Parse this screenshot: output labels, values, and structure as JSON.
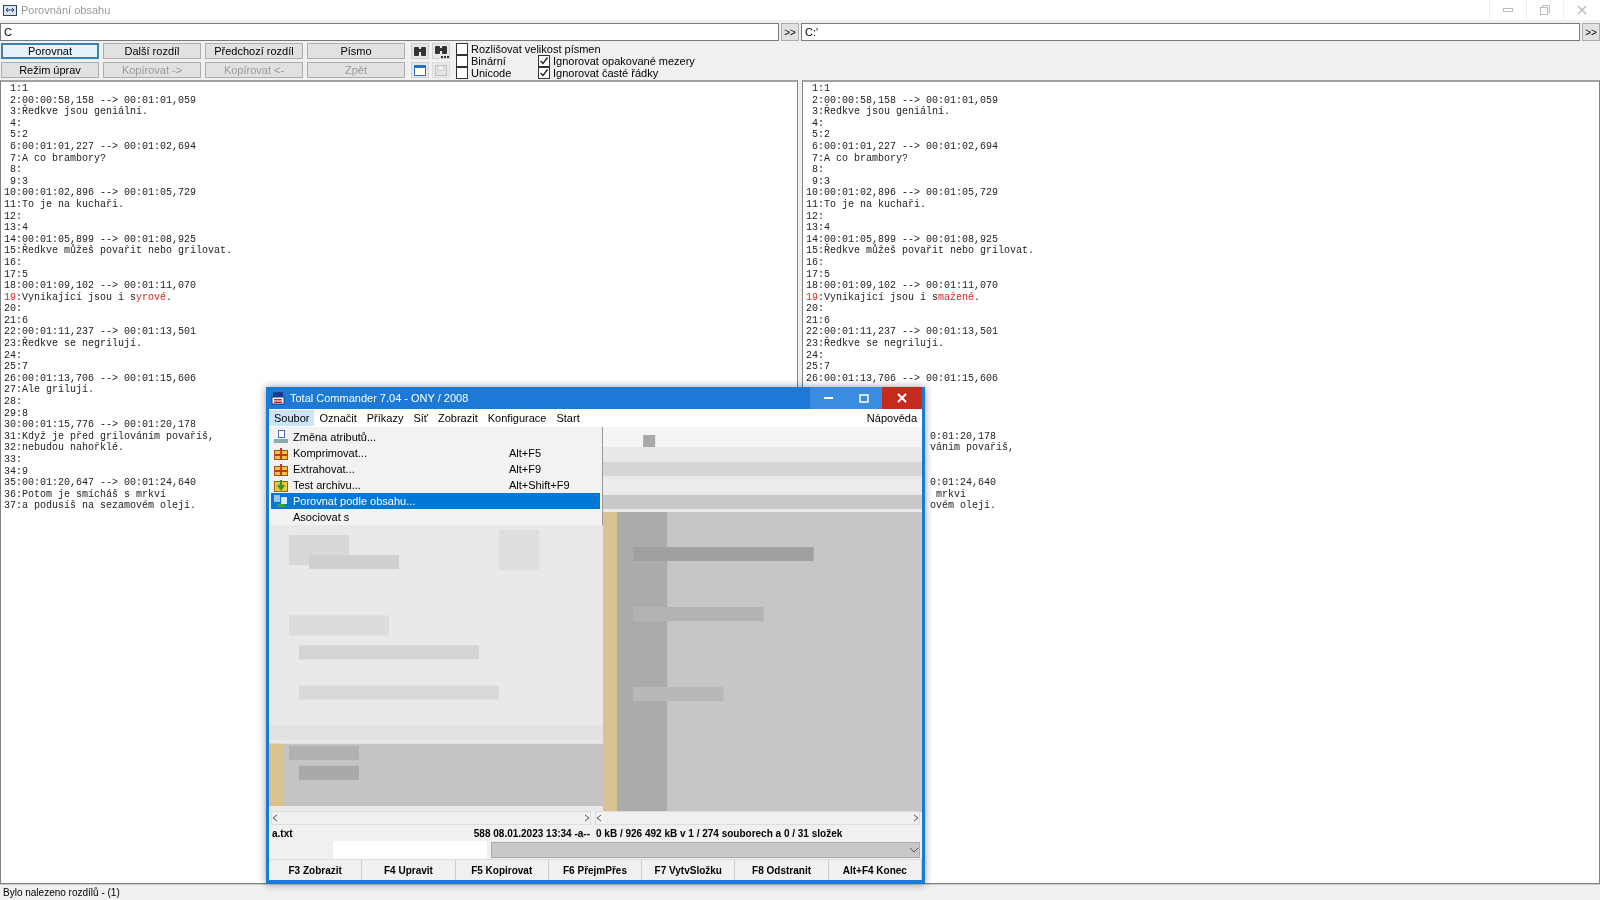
{
  "window": {
    "title": "Porovnání obsahu"
  },
  "paths": [
    {
      "value": "C",
      "button": ">>"
    },
    {
      "value": "C:'",
      "button": ">>"
    }
  ],
  "buttons": [
    {
      "label": "Porovnat",
      "disabled": false,
      "focused": true
    },
    {
      "label": "Další rozdíl",
      "disabled": false,
      "focused": false
    },
    {
      "label": "Předchozí rozdíl",
      "disabled": false,
      "focused": false
    },
    {
      "label": "Písmo",
      "disabled": false,
      "focused": false
    },
    {
      "label": "Režim úprav",
      "disabled": false,
      "focused": false
    },
    {
      "label": "Kopírovat ->",
      "disabled": true,
      "focused": false
    },
    {
      "label": "Kopírovat <-",
      "disabled": true,
      "focused": false
    },
    {
      "label": "Zpět",
      "disabled": true,
      "focused": false
    }
  ],
  "icon_buttons": [
    {
      "kind": "find",
      "disabled": false
    },
    {
      "kind": "find-next",
      "disabled": false
    },
    {
      "kind": "window",
      "disabled": false
    },
    {
      "kind": "save",
      "disabled": true
    }
  ],
  "options": [
    {
      "label": "Rozlišovat velikost písmen",
      "checked": false
    },
    {
      "label": "Binární",
      "checked": false
    },
    {
      "label": "Unicode",
      "checked": false
    },
    {
      "label": "Ignorovat opakované mezery",
      "checked": true
    },
    {
      "label": "Ignorovat časté řádky",
      "checked": true
    }
  ],
  "panes": [
    {
      "lines": [
        {
          "number": "1",
          "text": ":1",
          "differs": false
        },
        {
          "number": "2",
          "text": ":00:00:58,158 --> 00:01:01,059",
          "differs": false
        },
        {
          "number": "3",
          "text": ":Ředkve jsou geniální.",
          "differs": false
        },
        {
          "number": "4",
          "text": ":",
          "differs": false
        },
        {
          "number": "5",
          "text": ":2",
          "differs": false
        },
        {
          "number": "6",
          "text": ":00:01:01,227 --> 00:01:02,694",
          "differs": false
        },
        {
          "number": "7",
          "text": ":A co brambory?",
          "differs": false
        },
        {
          "number": "8",
          "text": ":",
          "differs": false
        },
        {
          "number": "9",
          "text": ":3",
          "differs": false
        },
        {
          "number": "10",
          "text": ":00:01:02,896 --> 00:01:05,729",
          "differs": false
        },
        {
          "number": "11",
          "text": ":To je na kuchaři.",
          "differs": false
        },
        {
          "number": "12",
          "text": ":",
          "differs": false
        },
        {
          "number": "13",
          "text": ":4",
          "differs": false
        },
        {
          "number": "14",
          "text": ":00:01:05,899 --> 00:01:08,925",
          "differs": false
        },
        {
          "number": "15",
          "text": ":Ředkve můžeš povařit nebo grilovat.",
          "differs": false
        },
        {
          "number": "16",
          "text": ":",
          "differs": false
        },
        {
          "number": "17",
          "text": ":5",
          "differs": false
        },
        {
          "number": "18",
          "text": ":00:01:09,102 --> 00:01:11,070",
          "differs": false
        },
        {
          "number": "19",
          "text": ":Vynikající jsou i s",
          "changed": "yrové",
          "after": ".",
          "differs": true
        },
        {
          "number": "20",
          "text": ":",
          "differs": false
        },
        {
          "number": "21",
          "text": ":6",
          "differs": false
        },
        {
          "number": "22",
          "text": ":00:01:11,237 --> 00:01:13,501",
          "differs": false
        },
        {
          "number": "23",
          "text": ":Ředkve se negrilují.",
          "differs": false
        },
        {
          "number": "24",
          "text": ":",
          "differs": false
        },
        {
          "number": "25",
          "text": ":7",
          "differs": false
        },
        {
          "number": "26",
          "text": ":00:01:13,706 --> 00:01:15,606",
          "differs": false
        },
        {
          "number": "27",
          "text": ":Ale grilují.",
          "differs": false
        },
        {
          "number": "28",
          "text": ":",
          "differs": false
        },
        {
          "number": "29",
          "text": ":8",
          "differs": false
        },
        {
          "number": "30",
          "text": ":00:01:15,776 --> 00:01:20,178",
          "differs": false
        },
        {
          "number": "31",
          "text": ":Když je před grilováním povaříš,",
          "differs": false
        },
        {
          "number": "32",
          "text": ":nebudou nahořklé.",
          "differs": false
        },
        {
          "number": "33",
          "text": ":",
          "differs": false
        },
        {
          "number": "34",
          "text": ":9",
          "differs": false
        },
        {
          "number": "35",
          "text": ":00:01:20,647 --> 00:01:24,640",
          "differs": false
        },
        {
          "number": "36",
          "text": ":Potom je smícháš s mrkví",
          "differs": false
        },
        {
          "number": "37",
          "text": ":a podusíš na sezamovém oleji.",
          "differs": false
        }
      ]
    },
    {
      "lines": [
        {
          "number": "1",
          "text": ":1",
          "differs": false
        },
        {
          "number": "2",
          "text": ":00:00:58,158 --> 00:01:01,059",
          "differs": false
        },
        {
          "number": "3",
          "text": ":Ředkve jsou geniální.",
          "differs": false
        },
        {
          "number": "4",
          "text": ":",
          "differs": false
        },
        {
          "number": "5",
          "text": ":2",
          "differs": false
        },
        {
          "number": "6",
          "text": ":00:01:01,227 --> 00:01:02,694",
          "differs": false
        },
        {
          "number": "7",
          "text": ":A co brambory?",
          "differs": false
        },
        {
          "number": "8",
          "text": ":",
          "differs": false
        },
        {
          "number": "9",
          "text": ":3",
          "differs": false
        },
        {
          "number": "10",
          "text": ":00:01:02,896 --> 00:01:05,729",
          "differs": false
        },
        {
          "number": "11",
          "text": ":To je na kuchaři.",
          "differs": false
        },
        {
          "number": "12",
          "text": ":",
          "differs": false
        },
        {
          "number": "13",
          "text": ":4",
          "differs": false
        },
        {
          "number": "14",
          "text": ":00:01:05,899 --> 00:01:08,925",
          "differs": false
        },
        {
          "number": "15",
          "text": ":Ředkve můžeš povařit nebo grilovat.",
          "differs": false
        },
        {
          "number": "16",
          "text": ":",
          "differs": false
        },
        {
          "number": "17",
          "text": ":5",
          "differs": false
        },
        {
          "number": "18",
          "text": ":00:01:09,102 --> 00:01:11,070",
          "differs": false
        },
        {
          "number": "19",
          "text": ":Vynikající jsou i s",
          "changed": "mažené",
          "after": ".",
          "differs": true
        },
        {
          "number": "20",
          "text": ":",
          "differs": false
        },
        {
          "number": "21",
          "text": ":6",
          "differs": false
        },
        {
          "number": "22",
          "text": ":00:01:11,237 --> 00:01:13,501",
          "differs": false
        },
        {
          "number": "23",
          "text": ":Ředkve se negrilují.",
          "differs": false
        },
        {
          "number": "24",
          "text": ":",
          "differs": false
        },
        {
          "number": "25",
          "text": ":7",
          "differs": false
        },
        {
          "number": "26",
          "text": ":00:01:13,706 --> 00:01:15,606",
          "differs": false
        }
      ],
      "tail_blocks": [
        {
          "lines": [
            "0:01:20,178",
            "vánim povařiš,"
          ]
        },
        {
          "lines": [
            "0:01:24,640",
            " mrkvi",
            "ovém oleji."
          ]
        }
      ]
    }
  ],
  "status_bar": {
    "text": "Bylo nalezeno rozdílů - (1)"
  },
  "commander": {
    "title": "Total Commander 7.04 - ONY / 2008",
    "menu": [
      {
        "label": "Soubor",
        "selected": true
      },
      {
        "label": "Označit",
        "selected": false
      },
      {
        "label": "Příkazy",
        "selected": false
      },
      {
        "label": "Síť",
        "selected": false
      },
      {
        "label": "Zobrazit",
        "selected": false
      },
      {
        "label": "Konfigurace",
        "selected": false
      },
      {
        "label": "Start",
        "selected": false
      }
    ],
    "help_menu": "Nápověda",
    "dropdown": [
      {
        "kind": "attributes",
        "label": "Změna atributů...",
        "selected": false
      },
      {
        "kind": "archive",
        "label": "Komprimovat...",
        "shortcut": "Alt+F5",
        "selected": false
      },
      {
        "kind": "archive",
        "label": "Extrahovat...",
        "shortcut": "Alt+F9",
        "selected": false
      },
      {
        "kind": "test",
        "label": "Test archivu...",
        "shortcut": "Alt+Shift+F9",
        "selected": false
      },
      {
        "kind": "compare",
        "label": "Porovnat podle obsahu...",
        "selected": true
      },
      {
        "kind": "plain",
        "label": "Asociovat s",
        "selected": false
      }
    ],
    "status_left": {
      "name": "a.txt",
      "details": "588 08.01.2023 13:34 -a--"
    },
    "status_right": "0 kB / 926 492 kB v 1 / 274 souborech a 0 / 31 složek",
    "function_keys": [
      "F3 Zobrazit",
      "F4 Upravit",
      "F5 Kopirovat",
      "F6 PřejmPřes",
      "F7 VytvSložku",
      "F8 Odstranit",
      "Alt+F4 Konec"
    ]
  }
}
